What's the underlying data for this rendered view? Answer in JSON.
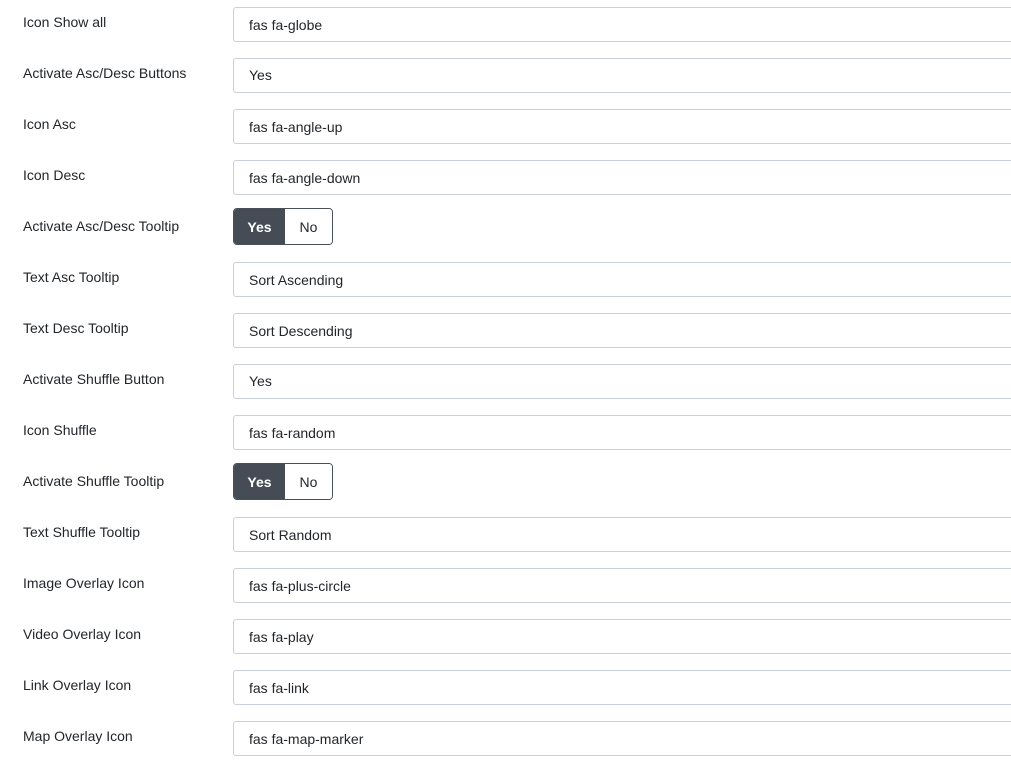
{
  "fields": [
    {
      "label": "Icon Show all",
      "value": "fas fa-globe"
    },
    {
      "label": "Activate Asc/Desc Buttons",
      "value": "Yes"
    },
    {
      "label": "Icon Asc",
      "value": "fas fa-angle-up"
    },
    {
      "label": "Icon Desc",
      "value": "fas fa-angle-down"
    },
    {
      "label": "Activate Asc/Desc Tooltip",
      "yes": "Yes",
      "no": "No",
      "selected": "Yes"
    },
    {
      "label": "Text Asc Tooltip",
      "value": "Sort Ascending"
    },
    {
      "label": "Text Desc Tooltip",
      "value": "Sort Descending"
    },
    {
      "label": "Activate Shuffle Button",
      "value": "Yes"
    },
    {
      "label": "Icon Shuffle",
      "value": "fas fa-random"
    },
    {
      "label": "Activate Shuffle Tooltip",
      "yes": "Yes",
      "no": "No",
      "selected": "Yes"
    },
    {
      "label": "Text Shuffle Tooltip",
      "value": "Sort Random"
    },
    {
      "label": "Image Overlay Icon",
      "value": "fas fa-plus-circle"
    },
    {
      "label": "Video Overlay Icon",
      "value": "fas fa-play"
    },
    {
      "label": "Link Overlay Icon",
      "value": "fas fa-link"
    },
    {
      "label": "Map Overlay Icon",
      "value": "fas fa-map-marker"
    }
  ],
  "colors": {
    "toggle_active_bg": "#454c55",
    "field_border": "#c8d0dc",
    "text": "#22262a"
  }
}
